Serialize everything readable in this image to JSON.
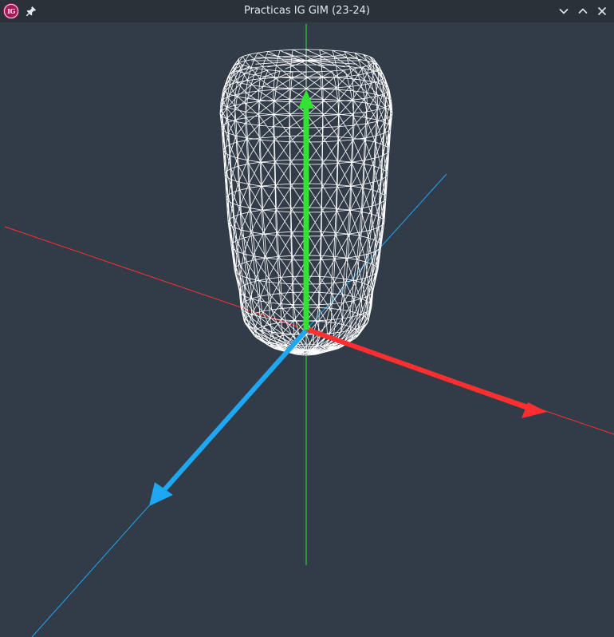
{
  "window": {
    "title": "Practicas IG GIM (23-24)",
    "app_icon": "IG",
    "icons": {
      "pin": "pin-icon",
      "minimize": "chevron-down-icon",
      "maximize": "chevron-up-icon",
      "close": "close-icon"
    }
  },
  "scene": {
    "background": "#323c49",
    "colors": {
      "x_axis": "#ff2f2f",
      "y_axis": "#33e233",
      "z_axis": "#1ea7f2",
      "mesh": "#ffffff"
    },
    "mesh": {
      "type": "wireframe-can",
      "style": "wireframe"
    }
  }
}
